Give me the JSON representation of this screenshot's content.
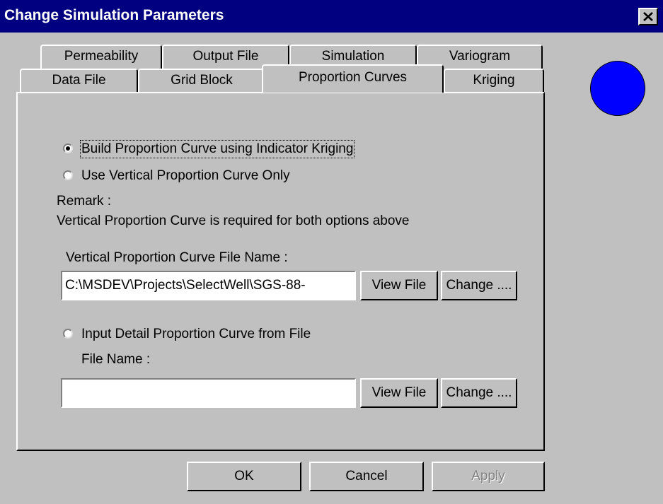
{
  "window": {
    "title": "Change Simulation Parameters"
  },
  "tabs": {
    "row_back": [
      "Permeability",
      "Output File",
      "Simulation",
      "Variogram"
    ],
    "row_front": [
      "Data File",
      "Grid Block",
      "Proportion Curves",
      "Kriging"
    ],
    "active": "Proportion Curves"
  },
  "panel": {
    "option_build": {
      "label": "Build Proportion Curve using Indicator Kriging",
      "checked": true
    },
    "option_vertical": {
      "label": "Use Vertical Proportion Curve Only",
      "checked": false
    },
    "remark_label": "Remark :",
    "remark_text": "Vertical Proportion Curve is required for both options above",
    "vertical_file": {
      "label": "Vertical Proportion Curve File Name :",
      "value": "C:\\MSDEV\\Projects\\SelectWell\\SGS-88-",
      "view_label": "View File",
      "change_label": "Change ...."
    },
    "option_detail": {
      "label": "Input Detail Proportion Curve from File",
      "checked": false
    },
    "detail_file": {
      "label": "File Name :",
      "value": "",
      "view_label": "View File",
      "change_label": "Change ...."
    }
  },
  "footer": {
    "ok": "OK",
    "cancel": "Cancel",
    "apply": "Apply"
  },
  "colors": {
    "titlebar": "#000080",
    "face": "#c0c0c0",
    "status_circle": "#0000ff"
  },
  "icons": {
    "close": "close-icon",
    "status": "status-indicator"
  }
}
